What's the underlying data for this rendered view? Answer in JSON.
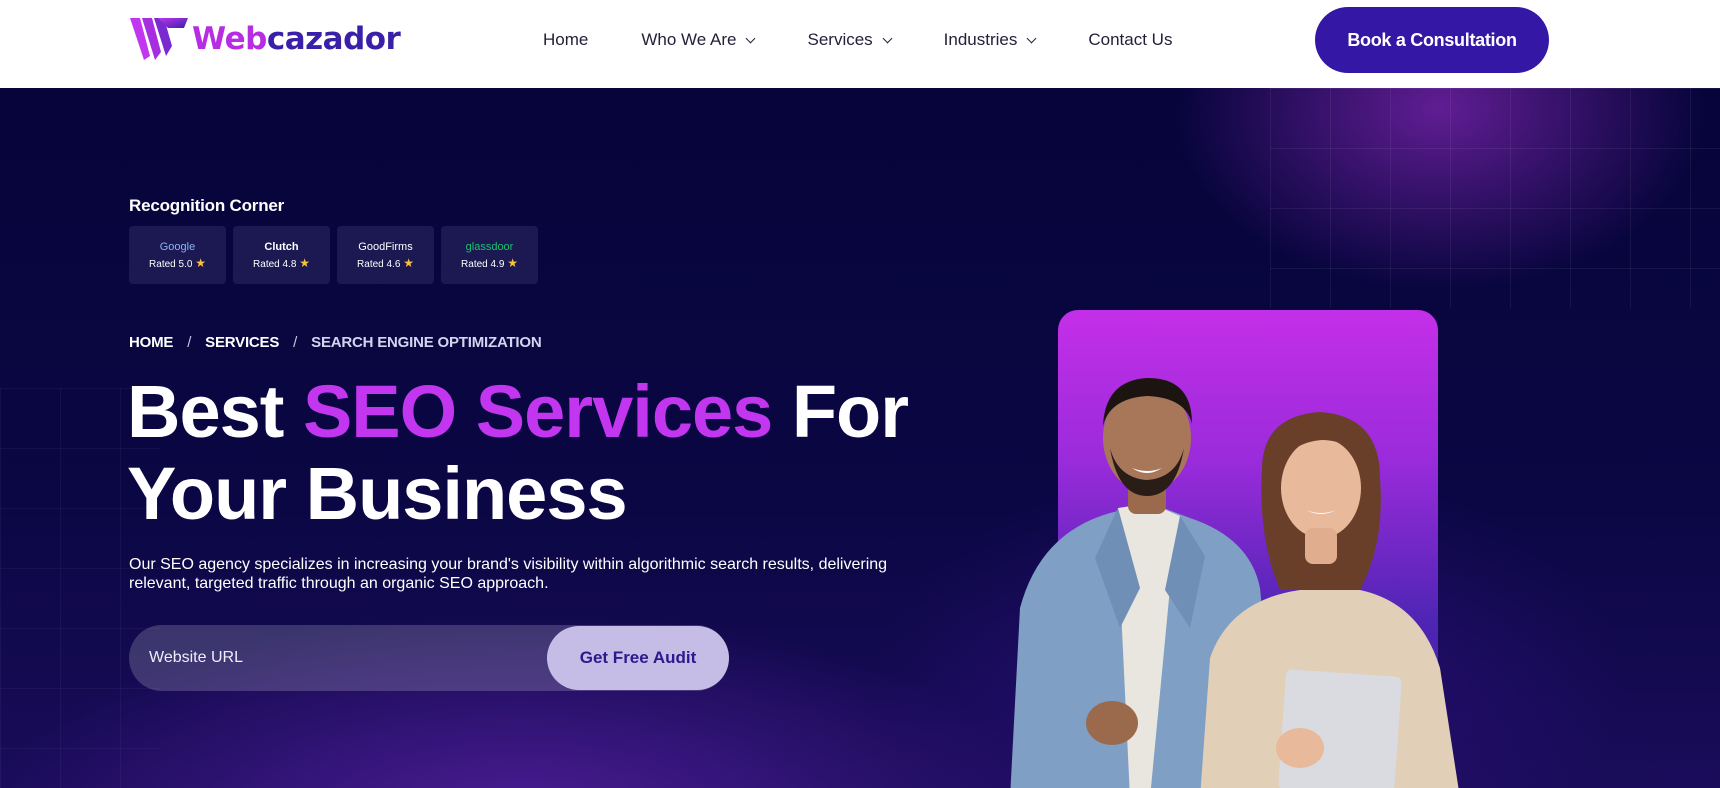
{
  "brand": {
    "name_part1": "Web",
    "name_part2": "cazador"
  },
  "nav": {
    "items": [
      {
        "label": "Home",
        "has_dropdown": false
      },
      {
        "label": "Who We Are",
        "has_dropdown": true
      },
      {
        "label": "Services",
        "has_dropdown": true
      },
      {
        "label": "Industries",
        "has_dropdown": true
      },
      {
        "label": "Contact Us",
        "has_dropdown": false
      }
    ],
    "cta_label": "Book a Consultation"
  },
  "recognition": {
    "title": "Recognition Corner",
    "badges": [
      {
        "brand": "Google",
        "rating": "Rated 5.0"
      },
      {
        "brand": "Clutch",
        "rating": "Rated 4.8"
      },
      {
        "brand": "GoodFirms",
        "rating": "Rated 4.6"
      },
      {
        "brand": "glassdoor",
        "rating": "Rated 4.9"
      }
    ]
  },
  "breadcrumb": {
    "items": [
      "HOME",
      "SERVICES",
      "SEARCH ENGINE OPTIMIZATION"
    ],
    "separator": "/"
  },
  "hero": {
    "headline_part1": "Best ",
    "headline_accent": "SEO Services",
    "headline_part2": " For",
    "headline_line2": "Your Business",
    "description": "Our SEO agency specializes in increasing your brand's visibility within algorithmic search results, delivering relevant, targeted traffic through an organic SEO approach.",
    "input_placeholder": "Website URL",
    "audit_button": "Get Free Audit"
  },
  "colors": {
    "accent_purple": "#c236ef",
    "cta_indigo": "#3517a6",
    "hero_bg": "#07053a"
  },
  "icons": {
    "star": "star-icon",
    "chevron": "chevron-down-icon"
  }
}
